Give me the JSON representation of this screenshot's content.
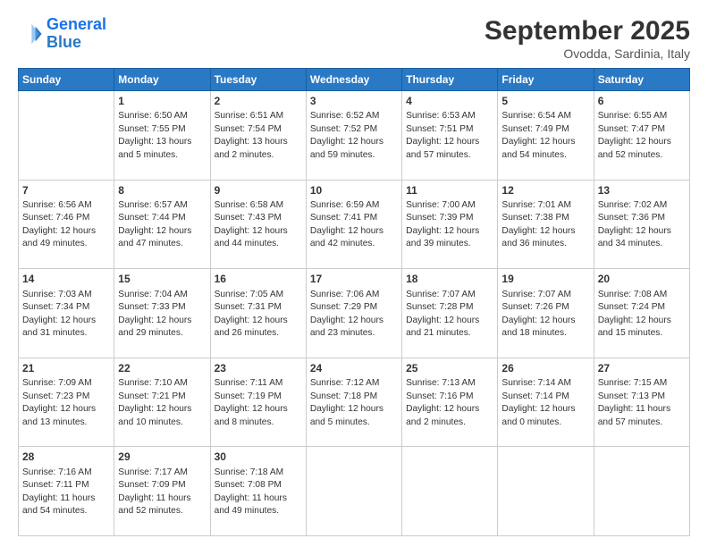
{
  "logo": {
    "line1": "General",
    "line2": "Blue"
  },
  "title": "September 2025",
  "location": "Ovodda, Sardinia, Italy",
  "days_header": [
    "Sunday",
    "Monday",
    "Tuesday",
    "Wednesday",
    "Thursday",
    "Friday",
    "Saturday"
  ],
  "weeks": [
    [
      {
        "day": "",
        "info": ""
      },
      {
        "day": "1",
        "info": "Sunrise: 6:50 AM\nSunset: 7:55 PM\nDaylight: 13 hours\nand 5 minutes."
      },
      {
        "day": "2",
        "info": "Sunrise: 6:51 AM\nSunset: 7:54 PM\nDaylight: 13 hours\nand 2 minutes."
      },
      {
        "day": "3",
        "info": "Sunrise: 6:52 AM\nSunset: 7:52 PM\nDaylight: 12 hours\nand 59 minutes."
      },
      {
        "day": "4",
        "info": "Sunrise: 6:53 AM\nSunset: 7:51 PM\nDaylight: 12 hours\nand 57 minutes."
      },
      {
        "day": "5",
        "info": "Sunrise: 6:54 AM\nSunset: 7:49 PM\nDaylight: 12 hours\nand 54 minutes."
      },
      {
        "day": "6",
        "info": "Sunrise: 6:55 AM\nSunset: 7:47 PM\nDaylight: 12 hours\nand 52 minutes."
      }
    ],
    [
      {
        "day": "7",
        "info": "Sunrise: 6:56 AM\nSunset: 7:46 PM\nDaylight: 12 hours\nand 49 minutes."
      },
      {
        "day": "8",
        "info": "Sunrise: 6:57 AM\nSunset: 7:44 PM\nDaylight: 12 hours\nand 47 minutes."
      },
      {
        "day": "9",
        "info": "Sunrise: 6:58 AM\nSunset: 7:43 PM\nDaylight: 12 hours\nand 44 minutes."
      },
      {
        "day": "10",
        "info": "Sunrise: 6:59 AM\nSunset: 7:41 PM\nDaylight: 12 hours\nand 42 minutes."
      },
      {
        "day": "11",
        "info": "Sunrise: 7:00 AM\nSunset: 7:39 PM\nDaylight: 12 hours\nand 39 minutes."
      },
      {
        "day": "12",
        "info": "Sunrise: 7:01 AM\nSunset: 7:38 PM\nDaylight: 12 hours\nand 36 minutes."
      },
      {
        "day": "13",
        "info": "Sunrise: 7:02 AM\nSunset: 7:36 PM\nDaylight: 12 hours\nand 34 minutes."
      }
    ],
    [
      {
        "day": "14",
        "info": "Sunrise: 7:03 AM\nSunset: 7:34 PM\nDaylight: 12 hours\nand 31 minutes."
      },
      {
        "day": "15",
        "info": "Sunrise: 7:04 AM\nSunset: 7:33 PM\nDaylight: 12 hours\nand 29 minutes."
      },
      {
        "day": "16",
        "info": "Sunrise: 7:05 AM\nSunset: 7:31 PM\nDaylight: 12 hours\nand 26 minutes."
      },
      {
        "day": "17",
        "info": "Sunrise: 7:06 AM\nSunset: 7:29 PM\nDaylight: 12 hours\nand 23 minutes."
      },
      {
        "day": "18",
        "info": "Sunrise: 7:07 AM\nSunset: 7:28 PM\nDaylight: 12 hours\nand 21 minutes."
      },
      {
        "day": "19",
        "info": "Sunrise: 7:07 AM\nSunset: 7:26 PM\nDaylight: 12 hours\nand 18 minutes."
      },
      {
        "day": "20",
        "info": "Sunrise: 7:08 AM\nSunset: 7:24 PM\nDaylight: 12 hours\nand 15 minutes."
      }
    ],
    [
      {
        "day": "21",
        "info": "Sunrise: 7:09 AM\nSunset: 7:23 PM\nDaylight: 12 hours\nand 13 minutes."
      },
      {
        "day": "22",
        "info": "Sunrise: 7:10 AM\nSunset: 7:21 PM\nDaylight: 12 hours\nand 10 minutes."
      },
      {
        "day": "23",
        "info": "Sunrise: 7:11 AM\nSunset: 7:19 PM\nDaylight: 12 hours\nand 8 minutes."
      },
      {
        "day": "24",
        "info": "Sunrise: 7:12 AM\nSunset: 7:18 PM\nDaylight: 12 hours\nand 5 minutes."
      },
      {
        "day": "25",
        "info": "Sunrise: 7:13 AM\nSunset: 7:16 PM\nDaylight: 12 hours\nand 2 minutes."
      },
      {
        "day": "26",
        "info": "Sunrise: 7:14 AM\nSunset: 7:14 PM\nDaylight: 12 hours\nand 0 minutes."
      },
      {
        "day": "27",
        "info": "Sunrise: 7:15 AM\nSunset: 7:13 PM\nDaylight: 11 hours\nand 57 minutes."
      }
    ],
    [
      {
        "day": "28",
        "info": "Sunrise: 7:16 AM\nSunset: 7:11 PM\nDaylight: 11 hours\nand 54 minutes."
      },
      {
        "day": "29",
        "info": "Sunrise: 7:17 AM\nSunset: 7:09 PM\nDaylight: 11 hours\nand 52 minutes."
      },
      {
        "day": "30",
        "info": "Sunrise: 7:18 AM\nSunset: 7:08 PM\nDaylight: 11 hours\nand 49 minutes."
      },
      {
        "day": "",
        "info": ""
      },
      {
        "day": "",
        "info": ""
      },
      {
        "day": "",
        "info": ""
      },
      {
        "day": "",
        "info": ""
      }
    ]
  ]
}
